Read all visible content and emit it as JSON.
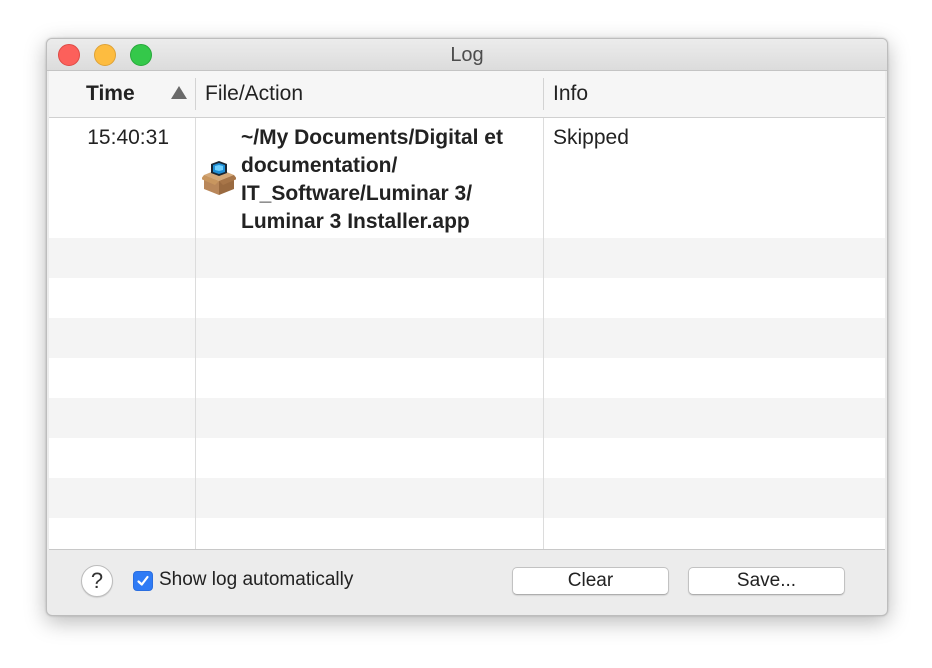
{
  "window": {
    "title": "Log"
  },
  "table": {
    "columns": [
      {
        "label": "Time",
        "sorted": "ascending"
      },
      {
        "label": "File/Action"
      },
      {
        "label": "Info"
      }
    ],
    "rows": [
      {
        "time": "15:40:31",
        "icon": "package-installer-icon",
        "file_lines": [
          "~/My Documents/Digital et",
          "documentation/",
          "IT_Software/Luminar 3/",
          "Luminar 3 Installer.app"
        ],
        "info": "Skipped"
      }
    ]
  },
  "footer": {
    "help_label": "?",
    "show_log_label": "Show log automatically",
    "show_log_checked": true,
    "clear_label": "Clear",
    "save_label": "Save..."
  },
  "colors": {
    "close": "#fc605b",
    "minimize": "#fdbc40",
    "zoom": "#34c84a",
    "checkbox_accent": "#2f7bf5",
    "stripe": "#f4f4f4"
  }
}
